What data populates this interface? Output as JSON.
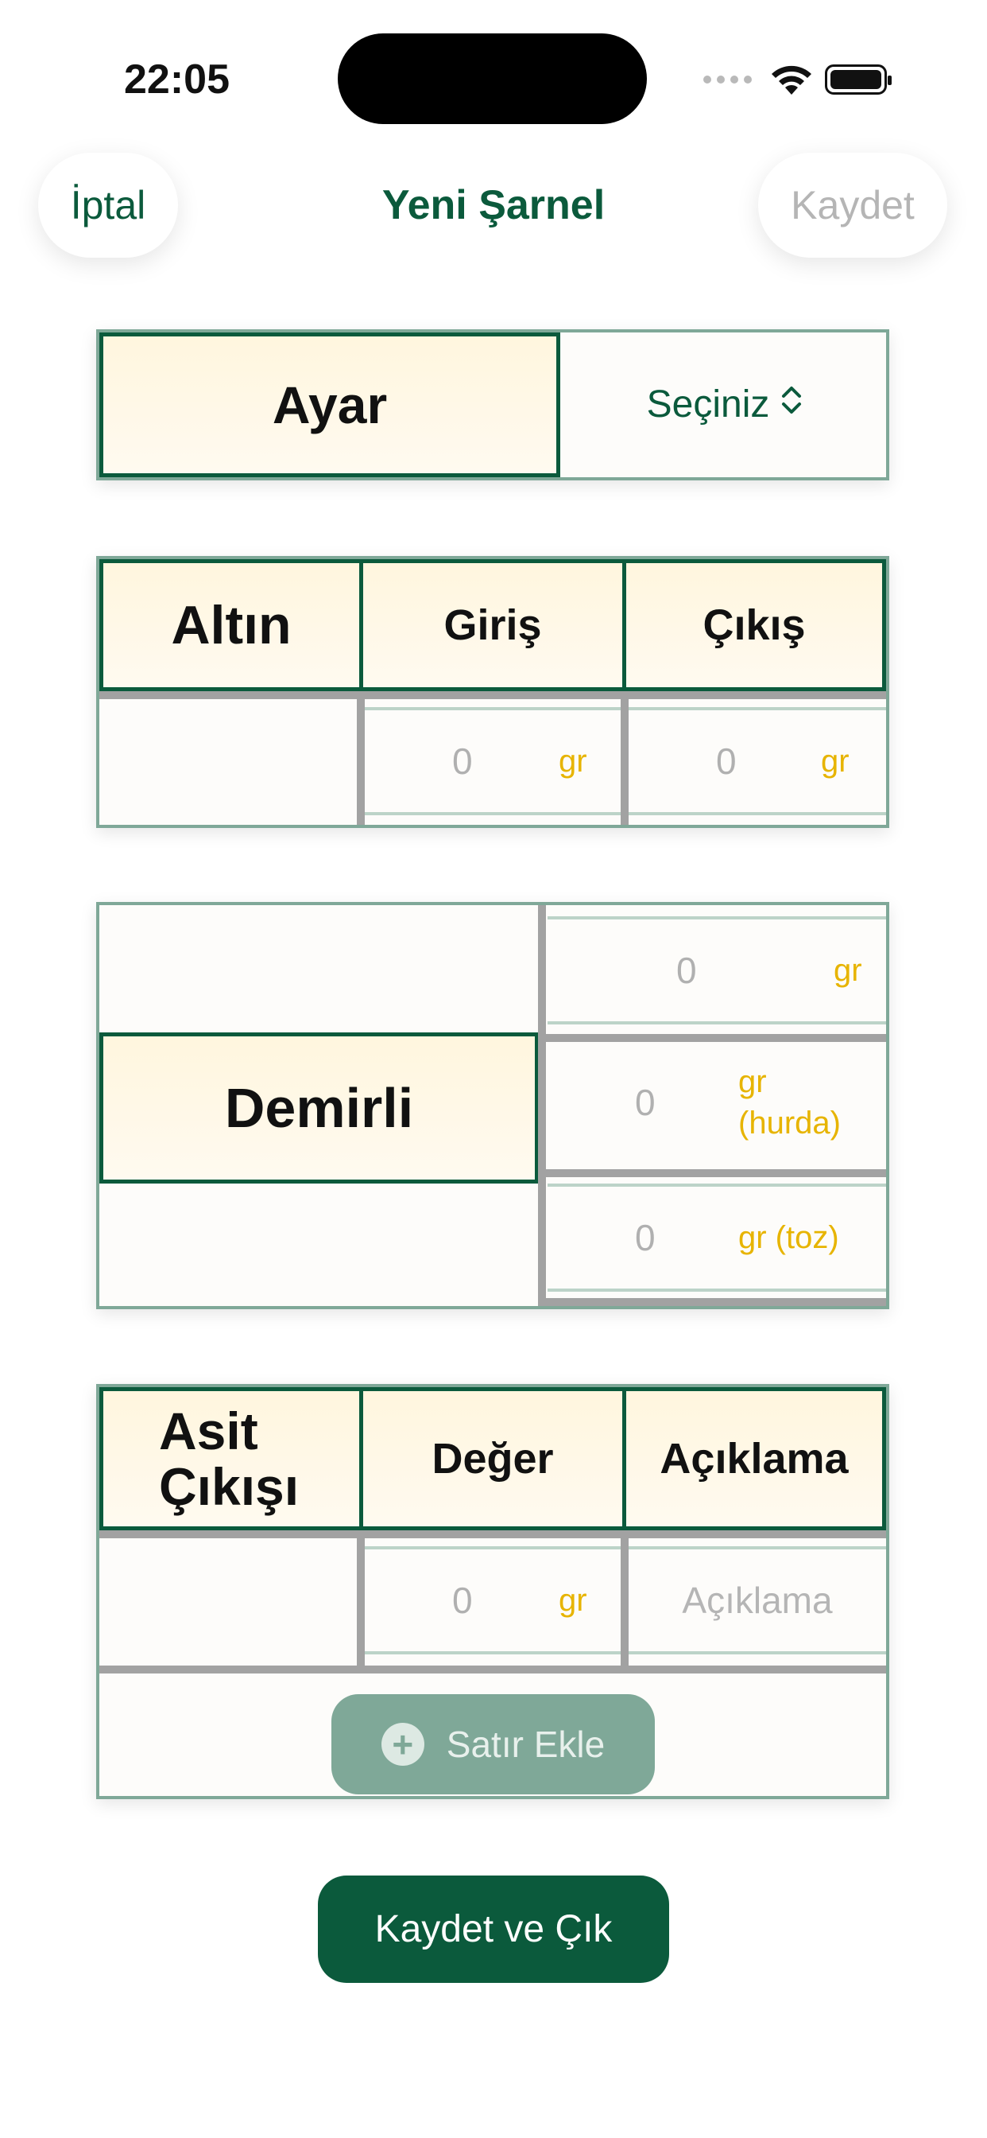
{
  "status_bar": {
    "time": "22:05",
    "wifi_icon": "wifi-icon",
    "battery_icon": "battery-icon"
  },
  "nav": {
    "cancel_label": "İptal",
    "title": "Yeni Şarnel",
    "save_label": "Kaydet"
  },
  "ayar": {
    "label": "Ayar",
    "select_value": "Seçiniz",
    "select_icon": "chevron-up-down-icon"
  },
  "altin": {
    "label": "Altın",
    "col_in": "Giriş",
    "col_out": "Çıkış",
    "in_value": "0",
    "in_unit": "gr",
    "out_value": "0",
    "out_unit": "gr"
  },
  "demirli": {
    "label": "Demirli",
    "rows": [
      {
        "value": "0",
        "unit": "gr"
      },
      {
        "value": "0",
        "unit": "gr (hurda)"
      },
      {
        "value": "0",
        "unit": "gr (toz)"
      }
    ]
  },
  "asit": {
    "label": "Asit Çıkışı",
    "col_value": "Değer",
    "col_desc": "Açıklama",
    "row_value": "0",
    "row_unit": "gr",
    "row_desc_placeholder": "Açıklama",
    "add_row_label": "Satır Ekle",
    "add_row_icon": "plus-circle-icon"
  },
  "footer": {
    "save_exit_label": "Kaydet ve Çık"
  },
  "colors": {
    "brand": "#0b5a3c",
    "border": "#7fa898",
    "unit": "#e7b400",
    "header_bg": "#fff6de"
  }
}
